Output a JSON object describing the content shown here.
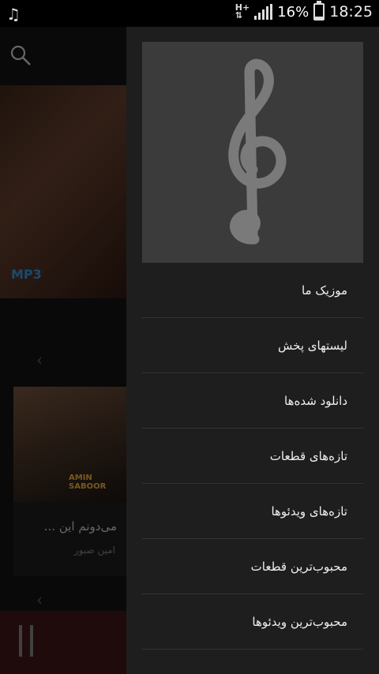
{
  "status_bar": {
    "network_label": "H+",
    "battery_percent": "16%",
    "battery_level": 0.16,
    "time": "18:25",
    "notification_icon": "music-note-icon"
  },
  "background": {
    "banner_label": "MP3",
    "card": {
      "cover_artist_text": "AMIN SABOOR",
      "title": "می‌دونم این ...",
      "artist": "امین صبور"
    }
  },
  "drawer": {
    "header_icon": "treble-clef-icon",
    "menu_items": [
      {
        "label": "موزیک ما"
      },
      {
        "label": "لیستهای پخش"
      },
      {
        "label": "دانلود شده‌ها"
      },
      {
        "label": "تازه‌های قطعات"
      },
      {
        "label": "تازه‌های ویدئوها"
      },
      {
        "label": "محبوب‌ترین قطعات"
      },
      {
        "label": "محبوب‌ترین ویدئوها"
      }
    ]
  }
}
